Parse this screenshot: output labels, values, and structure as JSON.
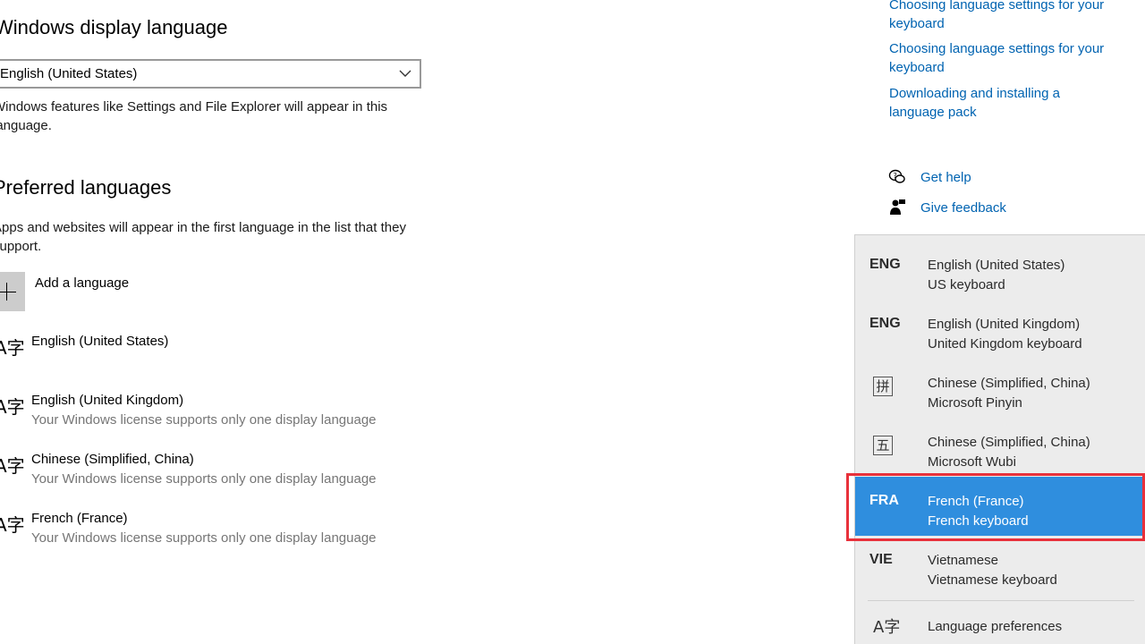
{
  "display_language": {
    "heading": "Windows display language",
    "selected": "English (United States)",
    "description_line1": "Windows features like Settings and File Explorer will appear in this",
    "description_line2": "language."
  },
  "preferred_languages": {
    "heading": "Preferred languages",
    "description_line1": "Apps and websites will appear in the first language in the list that they",
    "description_line2": "support.",
    "add_label": "Add a language",
    "glyph": "A字",
    "items": [
      {
        "name": "English (United States)",
        "note": ""
      },
      {
        "name": "English (United Kingdom)",
        "note": "Your Windows license supports only one display language"
      },
      {
        "name": "Chinese (Simplified, China)",
        "note": "Your Windows license supports only one display language"
      },
      {
        "name": "French (France)",
        "note": "Your Windows license supports only one display language"
      }
    ],
    "feature_icons": [
      "language-pack-icon",
      "text-to-speech-icon",
      "speech-microphone-icon",
      "handwriting-icon",
      "spellcheck-icon"
    ]
  },
  "related": {
    "links": [
      {
        "line1": "Choosing language settings for your",
        "line2": "keyboard"
      },
      {
        "line1": "Choosing language settings for your",
        "line2": "keyboard"
      },
      {
        "line1": "Downloading and installing a",
        "line2": "language pack"
      }
    ],
    "get_help": "Get help",
    "give_feedback": "Give feedback"
  },
  "input_flyout": {
    "items": [
      {
        "abbr": "ENG",
        "language": "English (United States)",
        "keyboard": "US keyboard"
      },
      {
        "abbr": "ENG",
        "language": "English (United Kingdom)",
        "keyboard": "United Kingdom keyboard"
      },
      {
        "ime_glyph": "拼",
        "language": "Chinese (Simplified, China)",
        "keyboard": "Microsoft Pinyin"
      },
      {
        "ime_glyph": "五",
        "language": "Chinese (Simplified, China)",
        "keyboard": "Microsoft Wubi"
      },
      {
        "abbr": "FRA",
        "language": "French (France)",
        "keyboard": "French keyboard"
      },
      {
        "abbr": "VIE",
        "language": "Vietnamese",
        "keyboard": "Vietnamese keyboard"
      }
    ],
    "selected_index": 4,
    "preferences_glyph": "A字",
    "preferences_label": "Language preferences",
    "selection_color": "#2f8ede",
    "highlight_color": "#e8313b"
  }
}
